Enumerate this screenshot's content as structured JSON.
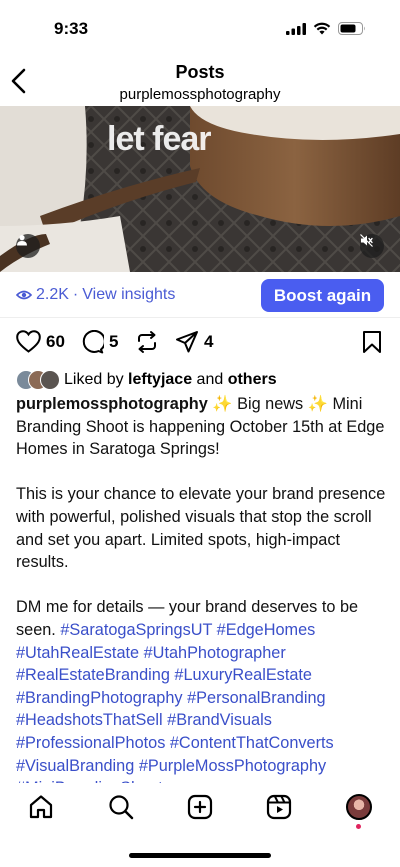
{
  "status": {
    "time": "9:33"
  },
  "header": {
    "title": "Posts",
    "username": "purplemossphotography"
  },
  "media": {
    "overlay_text": "let fear"
  },
  "insights": {
    "views": "2.2K",
    "separator": "·",
    "link_label": "View insights",
    "boost_label": "Boost again"
  },
  "actions": {
    "likes": "60",
    "comments": "5",
    "shares": "4"
  },
  "liked_by": {
    "prefix": "Liked by",
    "user": "leftyjace",
    "and": "and",
    "others": "others"
  },
  "caption": {
    "username": "purplemossphotography",
    "line1": " ✨ Big news ✨ Mini Branding Shoot is happening October 15th at Edge Homes in Saratoga Springs!",
    "para2": "This is your chance to elevate your brand presence with powerful, polished visuals that stop the scroll and set you apart. Limited spots, high-impact results.",
    "para3": "DM me for details — your brand deserves to be seen.",
    "hashtags": [
      "#SaratogaSpringsUT",
      "#EdgeHomes",
      "#UtahRealEstate",
      "#UtahPhotographer",
      "#RealEstateBranding",
      "#LuxuryRealEstate",
      "#BrandingPhotography",
      "#PersonalBranding",
      "#HeadshotsThatSell",
      "#BrandVisuals",
      "#ProfessionalPhotos",
      "#ContentThatConverts",
      "#VisualBranding",
      "#PurpleMossPhotography",
      "#MiniBrandingShoot"
    ]
  },
  "tabbar": {
    "items": [
      "home-icon",
      "search-icon",
      "create-icon",
      "reels-icon",
      "profile-avatar"
    ]
  },
  "colors": {
    "accent": "#4a5df0",
    "link": "#3a4fc9",
    "notification": "#e0245e"
  }
}
